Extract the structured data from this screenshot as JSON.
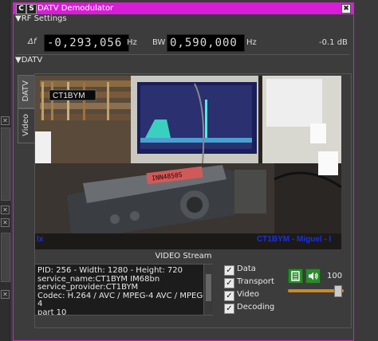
{
  "window": {
    "title": "DATV Demodulator",
    "c_badge": "C",
    "s_badge": "S",
    "close_glyph": "✖"
  },
  "rf_settings": {
    "header": "RF Settings",
    "delta_label": "Δf",
    "delta_value": "-0,293,056",
    "delta_unit": "Hz",
    "bw_label": "BW",
    "bw_value": "0,590,000",
    "bw_unit": "Hz",
    "level": "-0.1 dB"
  },
  "datv": {
    "header": "DATV",
    "tabs": [
      "DATV",
      "Video"
    ],
    "video_label": "VIDEO Stream",
    "overlay_callsign": "CT1BYM",
    "overlay_radio": "INN4850S",
    "overlay_bottom": "CT1BYM - Miguel - I",
    "overlay_left": "lx",
    "info_lines": [
      "PID: 256 - Width: 1280 - Height: 720",
      "service_name:CT1BYM IM68bn",
      "service_provider:CT1BYM",
      "Codec: H.264 / AVC / MPEG-4 AVC / MPEG-4",
      "part 10"
    ],
    "checkboxes": [
      {
        "label": "Data",
        "checked": true
      },
      {
        "label": "Transport",
        "checked": true
      },
      {
        "label": "Video",
        "checked": true
      },
      {
        "label": "Decoding",
        "checked": true
      }
    ],
    "check_glyph": "✓",
    "volume_value": "100",
    "volume_level": 1.0
  },
  "colors": {
    "title_bar": "#d81cd8",
    "button_green": "#2c8a2c",
    "slider": "#d08a20"
  }
}
